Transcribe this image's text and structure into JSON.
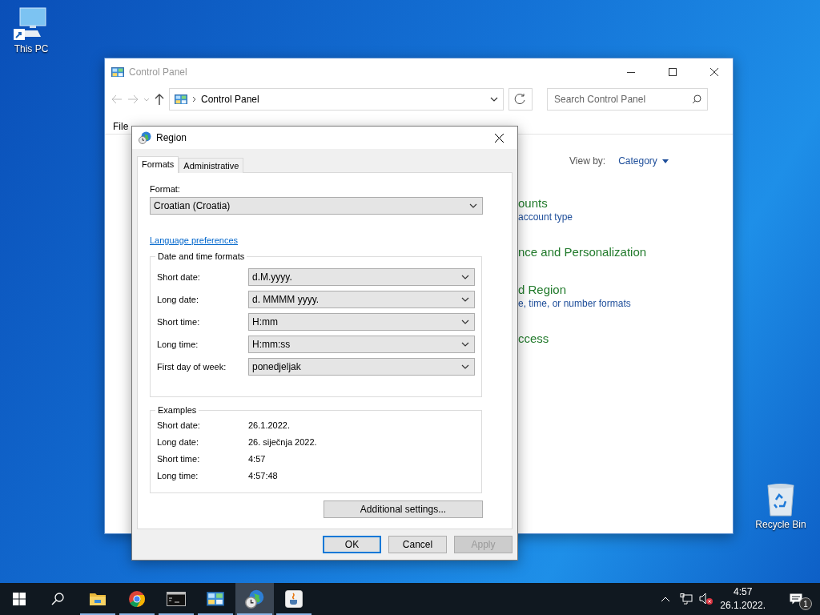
{
  "desktop_icons": [
    {
      "label": "This PC",
      "kind": "computer"
    },
    {
      "label": "Recycle Bin",
      "kind": "bin"
    }
  ],
  "control_panel": {
    "title": "Control Panel",
    "address": "Control Panel",
    "search": {
      "placeholder": "Search Control Panel"
    },
    "menu": [
      "File"
    ],
    "view_by_label": "View by:",
    "view_by_value": "Category",
    "categories": [
      {
        "title": "ounts",
        "link": "account type"
      },
      {
        "title": "nce and Personalization"
      },
      {
        "title": "d Region",
        "link": "e, time, or number formats"
      },
      {
        "title": "ccess"
      }
    ]
  },
  "region_dialog": {
    "title": "Region",
    "tabs": [
      {
        "label": "Formats",
        "selected": true
      },
      {
        "label": "Administrative",
        "selected": false
      }
    ],
    "format_label": "Format:",
    "format_value": "Croatian (Croatia)",
    "language_link": "Language preferences",
    "date_time_formats": {
      "title": "Date and time formats",
      "rows": [
        {
          "label": "Short date:",
          "value": "d.M.yyyy."
        },
        {
          "label": "Long date:",
          "value": "d. MMMM yyyy."
        },
        {
          "label": "Short time:",
          "value": "H:mm"
        },
        {
          "label": "Long time:",
          "value": "H:mm:ss"
        },
        {
          "label": "First day of week:",
          "value": "ponedjeljak"
        }
      ]
    },
    "examples": {
      "title": "Examples",
      "rows": [
        {
          "label": "Short date:",
          "value": "26.1.2022."
        },
        {
          "label": "Long date:",
          "value": "26. siječnja 2022."
        },
        {
          "label": "Short time:",
          "value": "4:57"
        },
        {
          "label": "Long time:",
          "value": "4:57:48"
        }
      ]
    },
    "additional_button": "Additional settings...",
    "buttons": [
      {
        "label": "OK",
        "kind": "default",
        "disabled": false
      },
      {
        "label": "Cancel",
        "kind": "normal",
        "disabled": false
      },
      {
        "label": "Apply",
        "kind": "normal",
        "disabled": true
      }
    ]
  },
  "taskbar": {
    "apps": [
      {
        "kind": "explorer",
        "selected": false
      },
      {
        "kind": "browser",
        "selected": false
      },
      {
        "kind": "terminal",
        "selected": false
      },
      {
        "kind": "control",
        "selected": false
      },
      {
        "kind": "region",
        "selected": true
      },
      {
        "kind": "java",
        "selected": false
      }
    ],
    "time": "4:57",
    "date": "26.1.2022.",
    "notifications": "1"
  }
}
